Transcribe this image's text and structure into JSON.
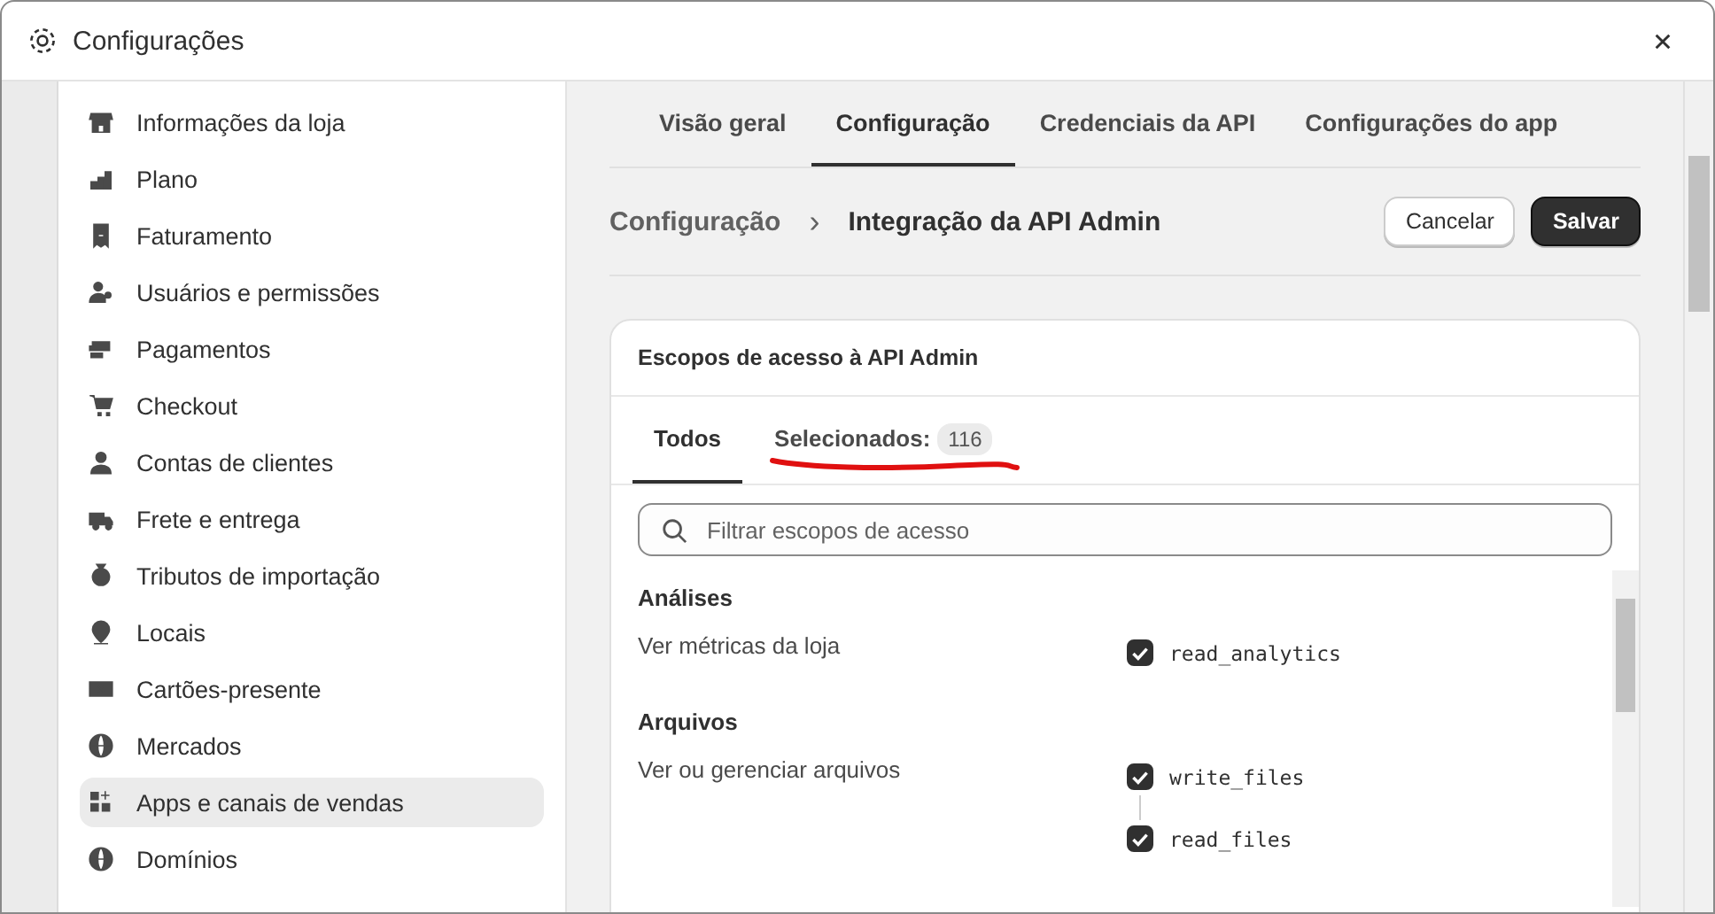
{
  "window": {
    "title": "Configurações"
  },
  "sidebar": {
    "items": [
      {
        "label": "Informações da loja",
        "selected": false
      },
      {
        "label": "Plano",
        "selected": false
      },
      {
        "label": "Faturamento",
        "selected": false
      },
      {
        "label": "Usuários e permissões",
        "selected": false
      },
      {
        "label": "Pagamentos",
        "selected": false
      },
      {
        "label": "Checkout",
        "selected": false
      },
      {
        "label": "Contas de clientes",
        "selected": false
      },
      {
        "label": "Frete e entrega",
        "selected": false
      },
      {
        "label": "Tributos de importação",
        "selected": false
      },
      {
        "label": "Locais",
        "selected": false
      },
      {
        "label": "Cartões-presente",
        "selected": false
      },
      {
        "label": "Mercados",
        "selected": false
      },
      {
        "label": "Apps e canais de vendas",
        "selected": true
      },
      {
        "label": "Domínios",
        "selected": false
      }
    ]
  },
  "tabs": [
    {
      "label": "Visão geral",
      "selected": false
    },
    {
      "label": "Configuração",
      "selected": true
    },
    {
      "label": "Credenciais da API",
      "selected": false
    },
    {
      "label": "Configurações do app",
      "selected": false
    }
  ],
  "breadcrumb": {
    "parent": "Configuração",
    "separator": "›",
    "current": "Integração da API Admin"
  },
  "actions": {
    "cancel": "Cancelar",
    "save": "Salvar"
  },
  "card": {
    "title": "Escopos de acesso à API Admin",
    "tabs": [
      {
        "label": "Todos",
        "selected": true
      },
      {
        "label": "Selecionados:",
        "selected": false,
        "count": "116"
      }
    ],
    "search": {
      "placeholder": "Filtrar escopos de acesso"
    },
    "sections": [
      {
        "title": "Análises",
        "description": "Ver métricas da loja",
        "scopes": [
          {
            "name": "read_analytics",
            "checked": true
          }
        ]
      },
      {
        "title": "Arquivos",
        "description": "Ver ou gerenciar arquivos",
        "scopes": [
          {
            "name": "write_files",
            "checked": true
          },
          {
            "name": "read_files",
            "checked": true
          }
        ]
      }
    ]
  }
}
